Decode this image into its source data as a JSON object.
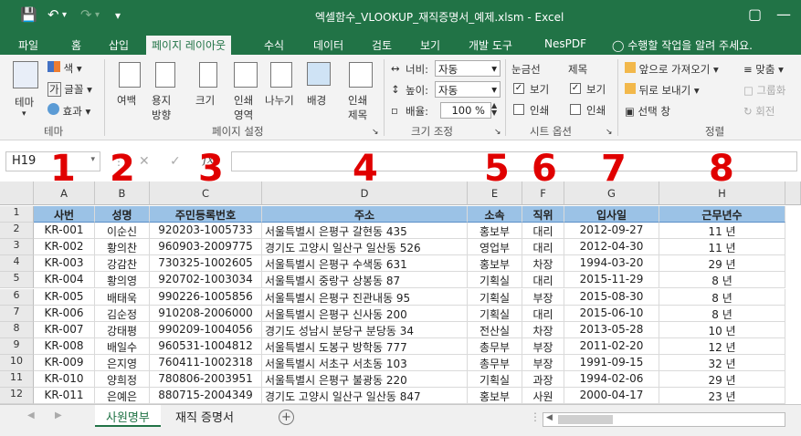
{
  "window": {
    "title": "엑셀함수_VLOOKUP_재직증명서_예제.xlsm - Excel"
  },
  "ribbon_tabs": [
    "파일",
    "홈",
    "삽입",
    "페이지 레이아웃",
    "수식",
    "데이터",
    "검토",
    "보기",
    "개발 도구",
    "NesPDF"
  ],
  "tell_me": "수행할 작업을 알려 주세요.",
  "ribbon": {
    "theme": {
      "themes": "테마",
      "colors": "색",
      "fonts": "글꼴",
      "effects": "효과",
      "group": "테마"
    },
    "page_setup": {
      "margins": "여백",
      "orientation": "용지\n방향",
      "size": "크기",
      "print_area": "인쇄\n영역",
      "breaks": "나누기",
      "background": "배경",
      "print_titles": "인쇄\n제목",
      "group": "페이지 설정"
    },
    "scale": {
      "width_label": "너비:",
      "width_value": "자동",
      "height_label": "높이:",
      "height_value": "자동",
      "scale_label": "배율:",
      "scale_value": "100 %",
      "group": "크기 조정"
    },
    "sheet_options": {
      "gridlines": "눈금선",
      "headings": "제목",
      "view": "보기",
      "print": "인쇄",
      "group": "시트 옵션"
    },
    "arrange": {
      "bring_forward": "앞으로 가져오기",
      "send_backward": "뒤로 보내기",
      "selection_pane": "선택 창",
      "align": "맞춤",
      "group_btn": "그룹화",
      "rotate": "회전",
      "group": "정렬"
    }
  },
  "name_box": "H19",
  "annotations": [
    "1",
    "2",
    "3",
    "4",
    "5",
    "6",
    "7",
    "8"
  ],
  "columns": [
    "A",
    "B",
    "C",
    "D",
    "E",
    "F",
    "G",
    "H"
  ],
  "rows": [
    "1",
    "2",
    "3",
    "4",
    "5",
    "6",
    "7",
    "8",
    "9",
    "10",
    "11",
    "12"
  ],
  "table": {
    "headers": [
      "사번",
      "성명",
      "주민등록번호",
      "주소",
      "소속",
      "직위",
      "입사일",
      "근무년수"
    ],
    "data": [
      [
        "KR-001",
        "이순신",
        "920203-1005733",
        "서울특별시 은평구 갈현동 435",
        "홍보부",
        "대리",
        "2012-09-27",
        "11 년"
      ],
      [
        "KR-002",
        "황의찬",
        "960903-2009775",
        "경기도 고양시 일산구 일산동 526",
        "영업부",
        "대리",
        "2012-04-30",
        "11 년"
      ],
      [
        "KR-003",
        "강감찬",
        "730325-1002605",
        "서울특별시 은평구 수색동 631",
        "홍보부",
        "차장",
        "1994-03-20",
        "29 년"
      ],
      [
        "KR-004",
        "황의영",
        "920702-1003034",
        "서울특별시 중랑구 상봉동 87",
        "기획실",
        "대리",
        "2015-11-29",
        "8 년"
      ],
      [
        "KR-005",
        "배태욱",
        "990226-1005856",
        "서울특별시 은평구 진관내동 95",
        "기획실",
        "부장",
        "2015-08-30",
        "8 년"
      ],
      [
        "KR-006",
        "김순정",
        "910208-2006000",
        "서울특별시 은평구 신사동 200",
        "기획실",
        "대리",
        "2015-06-10",
        "8 년"
      ],
      [
        "KR-007",
        "강태평",
        "990209-1004056",
        "경기도 성남시 분당구 분당동 34",
        "전산실",
        "차장",
        "2013-05-28",
        "10 년"
      ],
      [
        "KR-008",
        "배일수",
        "960531-1004812",
        "서울특별시 도봉구 방학동 777",
        "총무부",
        "부장",
        "2011-02-20",
        "12 년"
      ],
      [
        "KR-009",
        "은지영",
        "760411-1002318",
        "서울특별시 서초구 서초동 103",
        "총무부",
        "부장",
        "1991-09-15",
        "32 년"
      ],
      [
        "KR-010",
        "양희정",
        "780806-2003951",
        "서울특별시 은평구 불광동 220",
        "기획실",
        "과장",
        "1994-02-06",
        "29 년"
      ],
      [
        "KR-011",
        "은예은",
        "880715-2004349",
        "경기도 고양시 일산구 일산동 847",
        "홍보부",
        "사원",
        "2000-04-17",
        "23 년"
      ]
    ]
  },
  "sheets": [
    "사원명부",
    "재직 증명서"
  ],
  "colors": {
    "excel_green": "#217346",
    "header_fill": "#9bc2e6",
    "annotation_red": "#e00000"
  }
}
